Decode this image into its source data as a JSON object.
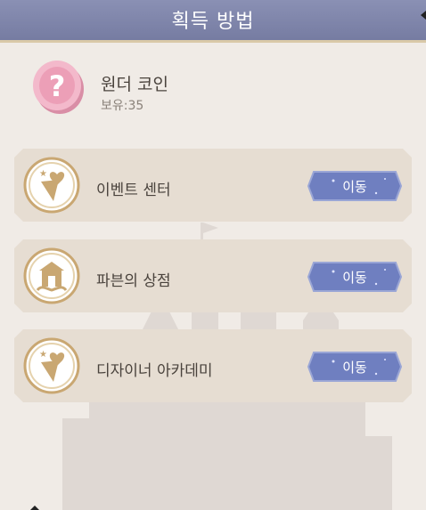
{
  "header": {
    "title": "획득 방법"
  },
  "item": {
    "name": "원더 코인",
    "owned": "보유:35",
    "icon": "wonder-coin-icon"
  },
  "sources": [
    {
      "label": "이벤트 센터",
      "icon": "ice-cream-heart-icon",
      "button": "이동"
    },
    {
      "label": "파븐의 상점",
      "icon": "shop-icon",
      "button": "이동"
    },
    {
      "label": "디자이너 아카데미",
      "icon": "ice-cream-heart-icon",
      "button": "이동"
    }
  ],
  "colors": {
    "header": "#7f85aa",
    "card": "#e6ddd2",
    "button": "#6f7fc0",
    "emblem": "#c9a772"
  }
}
